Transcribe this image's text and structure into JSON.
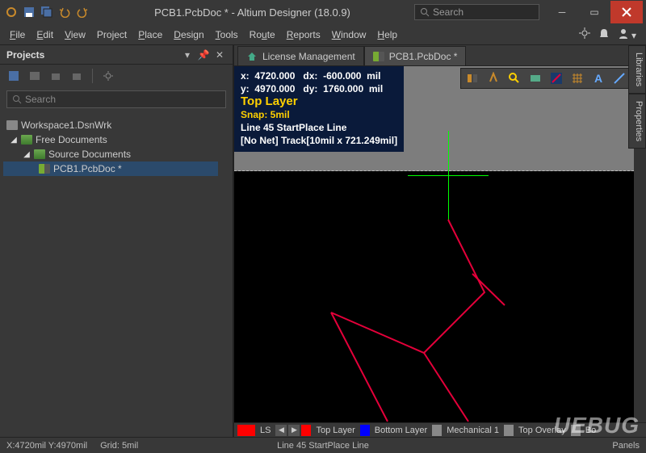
{
  "titlebar": {
    "title": "PCB1.PcbDoc * - Altium Designer (18.0.9)",
    "search_placeholder": "Search"
  },
  "menu": {
    "items": [
      "File",
      "Edit",
      "View",
      "Project",
      "Place",
      "Design",
      "Tools",
      "Route",
      "Reports",
      "Window",
      "Help"
    ]
  },
  "projects_panel": {
    "title": "Projects",
    "search_placeholder": "Search",
    "tree": {
      "workspace": "Workspace1.DsnWrk",
      "free_docs": "Free Documents",
      "source_docs": "Source Documents",
      "pcb_doc": "PCB1.PcbDoc *"
    }
  },
  "tabs": {
    "license": "License Management",
    "pcb": "PCB1.PcbDoc *"
  },
  "heads_up": {
    "x_label": "x:",
    "x_val": "4720.000",
    "dx_label": "dx:",
    "dx_val": "-600.000",
    "unit1": "mil",
    "y_label": "y:",
    "y_val": "4970.000",
    "dy_label": "dy:",
    "dy_val": "1760.000",
    "unit2": "mil",
    "layer": "Top Layer",
    "snap": "Snap: 5mil",
    "line1": "Line 45 StartPlace Line",
    "line2": "[No Net] Track[10mil x 721.249mil]"
  },
  "layer_bar": {
    "ls": "LS",
    "top": "Top Layer",
    "bottom": "Bottom Layer",
    "mech": "Mechanical 1",
    "overlay": "Top Overlay",
    "bo": "Bo"
  },
  "status": {
    "coords": "X:4720mil Y:4970mil",
    "grid": "Grid: 5mil",
    "mode": "Line 45 StartPlace Line",
    "panels": "Panels"
  },
  "side_tabs": {
    "libraries": "Libraries",
    "properties": "Properties"
  },
  "watermark": "UEBUG"
}
